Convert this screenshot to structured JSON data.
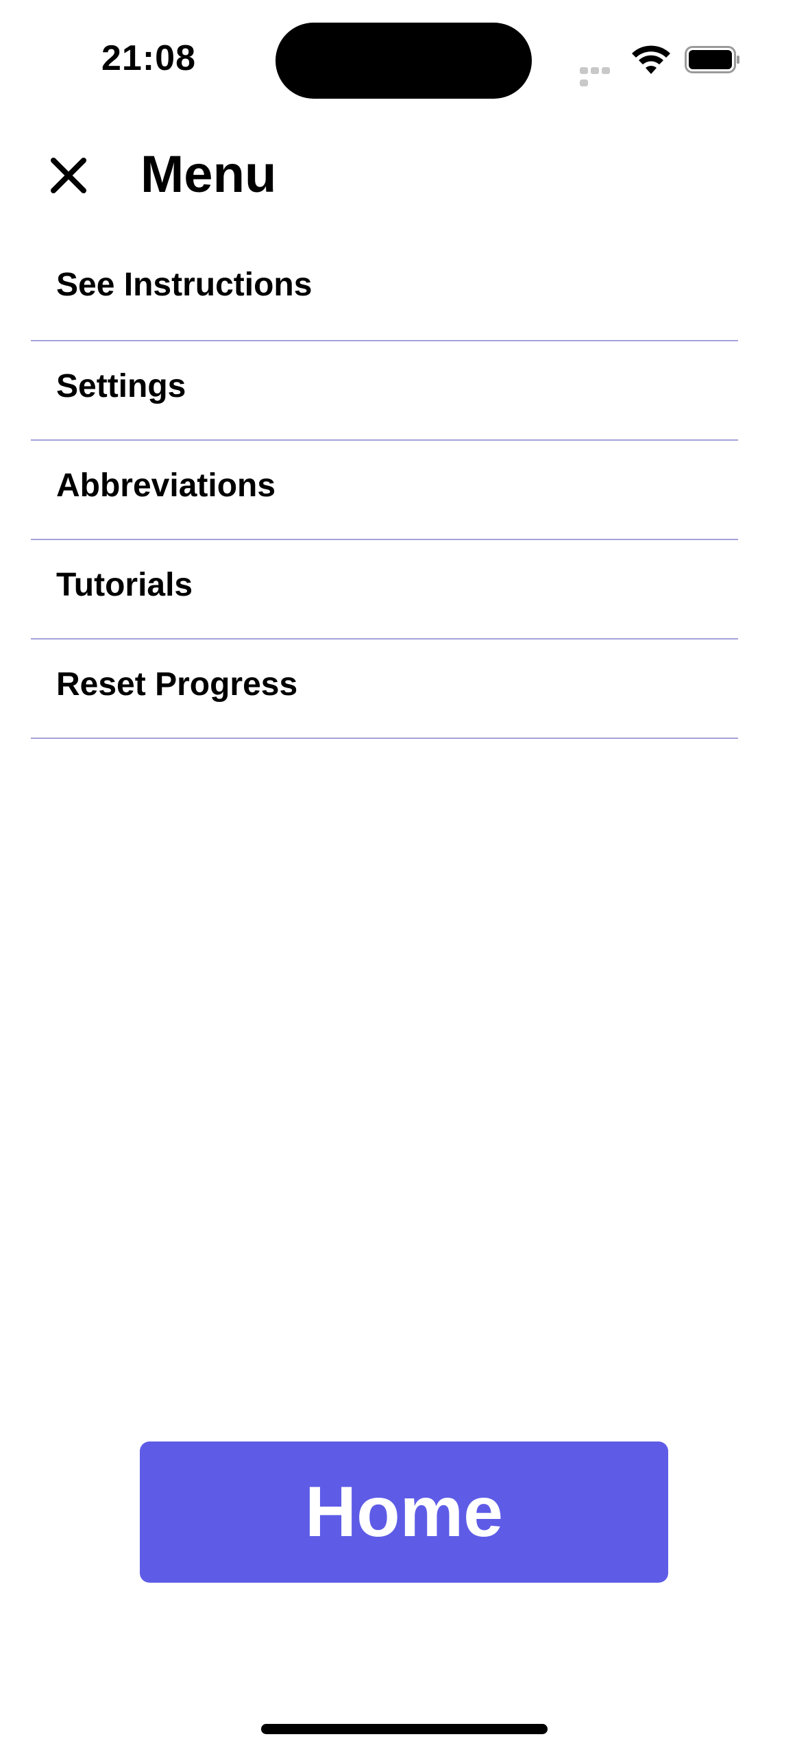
{
  "status_bar": {
    "time": "21:08",
    "icons": [
      "signal-icon",
      "wifi-icon",
      "battery-icon"
    ],
    "battery_level": 1.0
  },
  "header": {
    "close_icon": "close-icon",
    "title": "Menu"
  },
  "menu": {
    "items": [
      {
        "label": "See Instructions"
      },
      {
        "label": "Settings"
      },
      {
        "label": "Abbreviations"
      },
      {
        "label": "Tutorials"
      },
      {
        "label": "Reset Progress"
      }
    ]
  },
  "home_button": {
    "label": "Home"
  },
  "colors": {
    "accent": "#5e5ce6",
    "divider": "#a4a1da",
    "text": "#000000",
    "background": "#ffffff"
  }
}
